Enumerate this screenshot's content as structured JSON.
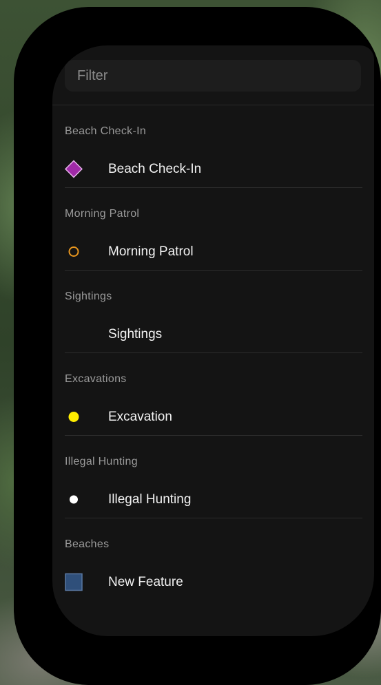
{
  "filter": {
    "placeholder": "Filter",
    "value": ""
  },
  "layers": [
    {
      "header": "Beach Check-In",
      "item": "Beach Check-In",
      "symbol": "diamond-icon",
      "color": "#a02aa8",
      "stroke": "#e6b3ea"
    },
    {
      "header": "Morning Patrol",
      "item": "Morning Patrol",
      "symbol": "hollow-circle-icon",
      "color": "#e8961e",
      "stroke": "#e8961e"
    },
    {
      "header": "Sightings",
      "item": "Sightings",
      "symbol": "none",
      "color": "",
      "stroke": ""
    },
    {
      "header": "Excavations",
      "item": "Excavation",
      "symbol": "filled-circle-icon",
      "color": "#ffee00",
      "stroke": "#ffee00"
    },
    {
      "header": "Illegal Hunting",
      "item": "Illegal Hunting",
      "symbol": "filled-circle-icon",
      "color": "#ffffff",
      "stroke": "#ffffff"
    },
    {
      "header": "Beaches",
      "item": "New Feature",
      "symbol": "square-icon",
      "color": "#2f4f7a",
      "stroke": "#5a79a3"
    }
  ]
}
